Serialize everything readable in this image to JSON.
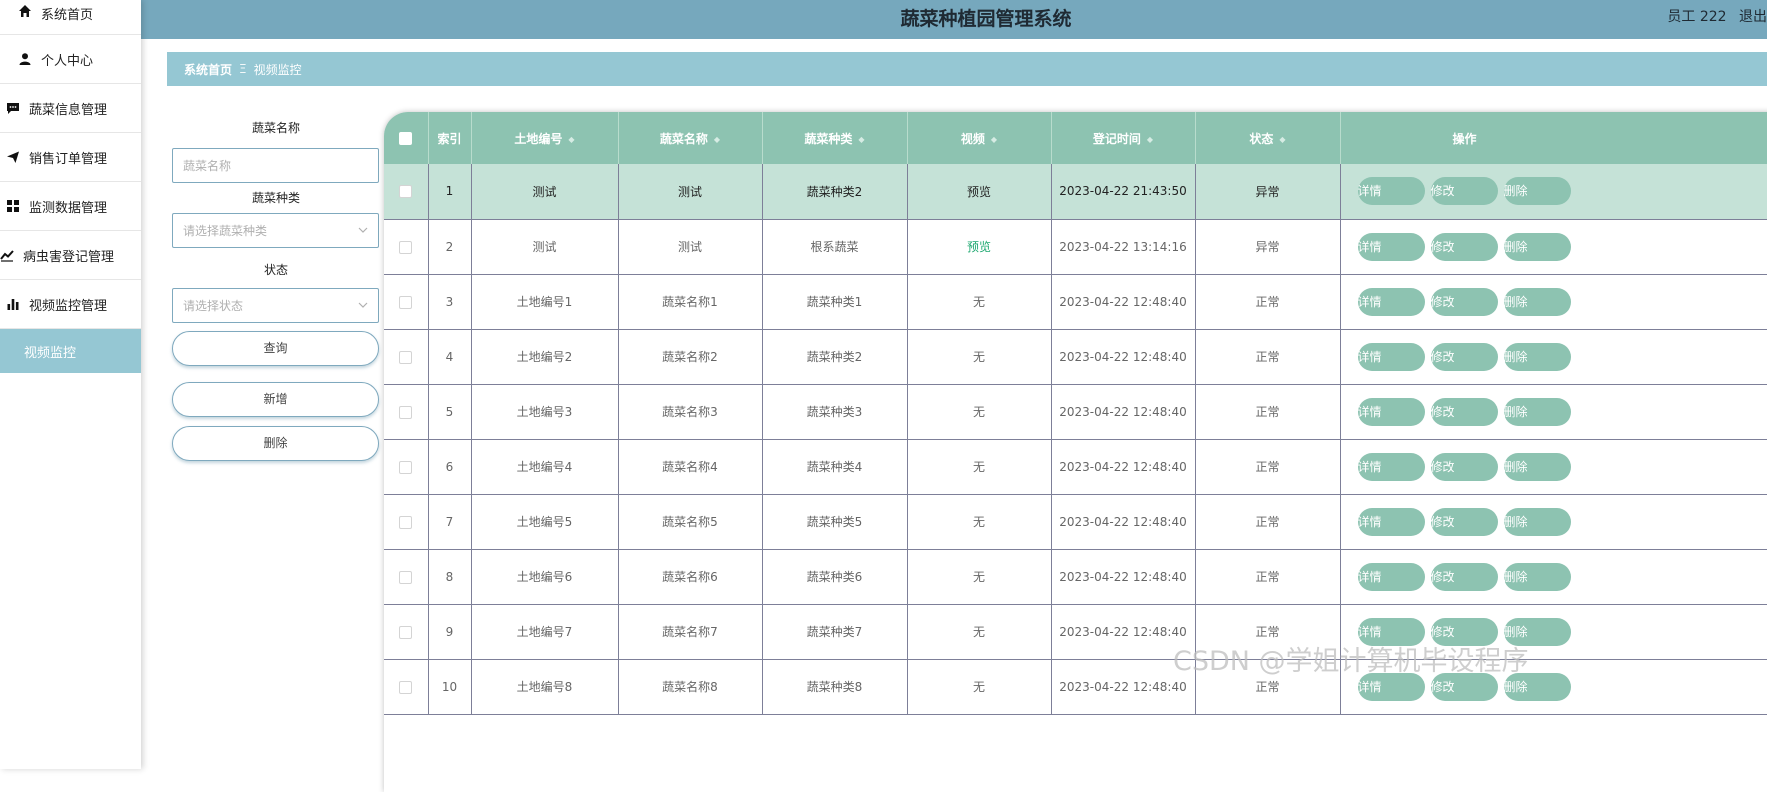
{
  "sidebar": {
    "items": [
      {
        "label": "系统首页",
        "icon": "home-icon"
      },
      {
        "label": "个人中心",
        "icon": "user-icon"
      },
      {
        "label": "蔬菜信息管理",
        "icon": "chat-icon"
      },
      {
        "label": "销售订单管理",
        "icon": "send-icon"
      },
      {
        "label": "监测数据管理",
        "icon": "grid-icon"
      },
      {
        "label": "病虫害登记管理",
        "icon": "trend-icon"
      },
      {
        "label": "视频监控管理",
        "icon": "bar-chart-icon"
      }
    ],
    "active_sub": "视频监控"
  },
  "header": {
    "title": "蔬菜种植园管理系统",
    "user_text": "员工 222",
    "logout_text": "退出"
  },
  "breadcrumb": {
    "home": "系统首页",
    "separator": "Ξ",
    "current": "视频监控"
  },
  "search": {
    "name_label": "蔬菜名称",
    "name_placeholder": "蔬菜名称",
    "type_label": "蔬菜种类",
    "type_placeholder": "请选择蔬菜种类",
    "status_label": "状态",
    "status_placeholder": "请选择状态",
    "query_button": "查询",
    "add_button": "新增",
    "delete_button": "删除"
  },
  "table": {
    "columns": [
      "索引",
      "土地编号",
      "蔬菜名称",
      "蔬菜种类",
      "视频",
      "登记时间",
      "状态",
      "操作"
    ],
    "action_labels": {
      "detail": "详情",
      "edit": "修改",
      "delete": "删除"
    },
    "rows": [
      {
        "index": "1",
        "land": "测试",
        "name": "测试",
        "type": "蔬菜种类2",
        "video": "预览",
        "time": "2023-04-22 21:43:50",
        "status": "异常"
      },
      {
        "index": "2",
        "land": "测试",
        "name": "测试",
        "type": "根系蔬菜",
        "video": "预览",
        "time": "2023-04-22 13:14:16",
        "status": "异常"
      },
      {
        "index": "3",
        "land": "土地编号1",
        "name": "蔬菜名称1",
        "type": "蔬菜种类1",
        "video": "无",
        "time": "2023-04-22 12:48:40",
        "status": "正常"
      },
      {
        "index": "4",
        "land": "土地编号2",
        "name": "蔬菜名称2",
        "type": "蔬菜种类2",
        "video": "无",
        "time": "2023-04-22 12:48:40",
        "status": "正常"
      },
      {
        "index": "5",
        "land": "土地编号3",
        "name": "蔬菜名称3",
        "type": "蔬菜种类3",
        "video": "无",
        "time": "2023-04-22 12:48:40",
        "status": "正常"
      },
      {
        "index": "6",
        "land": "土地编号4",
        "name": "蔬菜名称4",
        "type": "蔬菜种类4",
        "video": "无",
        "time": "2023-04-22 12:48:40",
        "status": "正常"
      },
      {
        "index": "7",
        "land": "土地编号5",
        "name": "蔬菜名称5",
        "type": "蔬菜种类5",
        "video": "无",
        "time": "2023-04-22 12:48:40",
        "status": "正常"
      },
      {
        "index": "8",
        "land": "土地编号6",
        "name": "蔬菜名称6",
        "type": "蔬菜种类6",
        "video": "无",
        "time": "2023-04-22 12:48:40",
        "status": "正常"
      },
      {
        "index": "9",
        "land": "土地编号7",
        "name": "蔬菜名称7",
        "type": "蔬菜种类7",
        "video": "无",
        "time": "2023-04-22 12:48:40",
        "status": "正常"
      },
      {
        "index": "10",
        "land": "土地编号8",
        "name": "蔬菜名称8",
        "type": "蔬菜种类8",
        "video": "无",
        "time": "2023-04-22 12:48:40",
        "status": "正常"
      }
    ]
  },
  "watermark": "CSDN @学姐计算机毕设程序",
  "colors": {
    "header": "#76a8bd",
    "accent": "#95c7d3",
    "table_header": "#8dc3b1",
    "row_highlight": "#c5e2d7",
    "preview_link": "#1ea870"
  }
}
